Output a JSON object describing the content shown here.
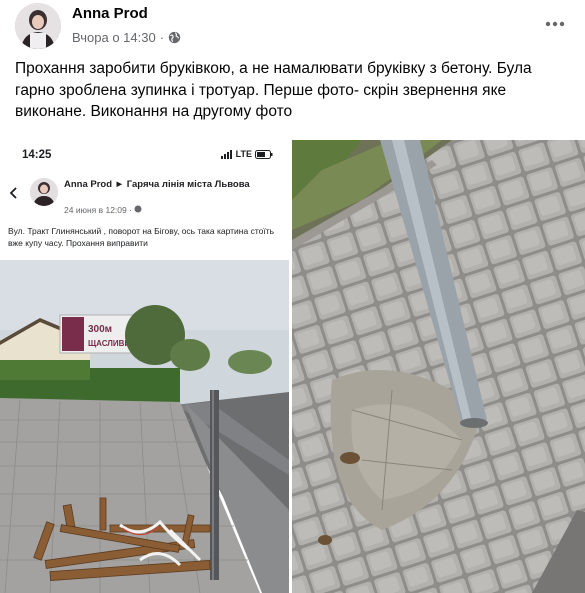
{
  "post": {
    "author": "Anna Prod",
    "timestamp": "Вчора о 14:30",
    "separator": "·",
    "more_icon": "more-horizontal-icon",
    "privacy_icon": "globe-icon",
    "text": "Прохання заробити бруківкою, а не намалювати бруківку з бетону. Була гарно зроблена зупинка і тротуар. Перше фото- скрін звернення яке виконане. Виконання на другому фото"
  },
  "screenshot": {
    "time": "14:25",
    "network": "LTE",
    "author": "Anna Prod",
    "arrow": "►",
    "group": "Гаряча лінія міста Львова",
    "date": "24 июня в 12:09",
    "dot": "·",
    "text": "Вул. Тракт Глинянський , поворот на Бігову, ось така картина стоїть вже купу часу. Прохання виправити",
    "billboard_number": "300м",
    "billboard_word": "ЩАСЛИВИЙ"
  },
  "colors": {
    "link_gray": "#65676b",
    "text": "#050505"
  }
}
